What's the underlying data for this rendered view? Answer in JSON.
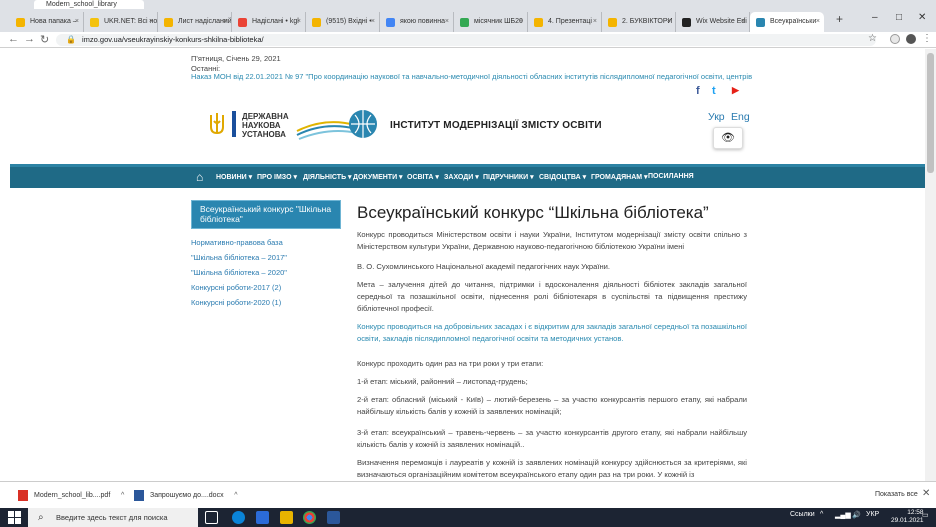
{
  "window": {
    "title": "Modern_school_library"
  },
  "tabs": [
    {
      "label": "Нова папака – ",
      "color": "#f4b400"
    },
    {
      "label": "UKR.NET: Всі но",
      "color": "#f4c20d"
    },
    {
      "label": "Лист надісланий",
      "color": "#f4b400"
    },
    {
      "label": "Надіслані • kgl",
      "color": "#ea4335"
    },
    {
      "label": "(9515) Вхідні • ",
      "color": "#f4b400"
    },
    {
      "label": "якою повинна",
      "color": "#4285f4"
    },
    {
      "label": "місячник ШБ20",
      "color": "#34a853"
    },
    {
      "label": "4. Презентаці",
      "color": "#f4b400"
    },
    {
      "label": "2. БУКВІКТОРИ",
      "color": "#f4b400"
    },
    {
      "label": "Wix Website Edi",
      "color": "#222222"
    },
    {
      "label": "Всеукраїнськи",
      "color": "#2a86b0"
    }
  ],
  "address": {
    "url": "imzo.gov.ua/vseukrayinskiy-konkurs-shkilna-biblioteka/"
  },
  "site": {
    "date": "П'ятниця, Січень 29, 2021",
    "latest_label": "Останні:",
    "ticker": "Наказ МОН від 22.01.2021 № 97 \"Про координацію наукової та навчально-методичної діяльності обласних інститутів післядипломної педагогічної освіти, центрів",
    "state_lines": [
      "ДЕРЖАВНА",
      "НАУКОВА",
      "УСТАНОВА"
    ],
    "institute": "ІНСТИТУТ МОДЕРНІЗАЦІЇ ЗМІСТУ ОСВІТИ",
    "lang_ukr": "Укр",
    "lang_eng": "Eng",
    "social": {
      "facebook": "f",
      "twitter": "t",
      "youtube": "▶"
    }
  },
  "menu": [
    "НОВИНИ ▾",
    "ПРО ІМЗО ▾",
    "ДІЯЛЬНІСТЬ ▾",
    "ДОКУМЕНТИ ▾",
    "ОСВІТА ▾",
    "ЗАХОДИ ▾",
    "ПІДРУЧНИКИ ▾",
    "СВІДОЦТВА ▾",
    "ГРОМАДЯНАМ ▾",
    "ПОСИЛАННЯ"
  ],
  "sidebar": {
    "heading": "Всеукраїнський конкурс \"Шкільна бібліотека\"",
    "links": [
      "Нормативно-правова база",
      "\"Шкільна бібліотека – 2017\"",
      "\"Шкільна бібліотека – 2020\"",
      "Конкурсні роботи-2017 (2)",
      "Конкурсні роботи-2020 (1)"
    ]
  },
  "article": {
    "title": "Всеукраїнський конкурс “Шкільна бібліотека”",
    "paragraphs": [
      "Конкурс проводиться Міністерством освіти і науки України, Інститутом модернізації змісту освіти спільно з Міністерством культури України, Державною науково-педагогічною бібліотекою України імені",
      "В. О. Сухомлинського Національної академії педагогічних наук України.",
      "Мета – залучення дітей до читання, підтримки і вдосконалення діяльності бібліотек закладів загальної середньої та позашкільної освіти, піднесення ролі бібліотекаря в суспільстві та підвищення престижу бібліотечної професії.",
      "Конкурс проводиться на добровільних засадах і є відкритим для закладів загальної середньої та позашкільної освіти, закладів післядипломної педагогічної освіти та методичних установ.",
      "Конкурс проходить один раз на три роки у три етапи:",
      "1-й етап: міський, районний – листопад-грудень;",
      "2-й етап: обласний (міський - Київ) – лютий-березень – за участю конкурсантів першого етапу, які набрали найбільшу кількість балів у кожній із заявлених номінацій;",
      "3-й етап: всеукраїнський – травень-червень – за участю конкурсантів другого етапу, які набрали найбільшу кількість балів у кожній із заявлених номінацій..",
      "Визначення переможців і лауреатів у кожній із заявлених номінацій конкурсу здійснюється за критеріями, які визначаються організаційним комітетом всеукраїнського етапу один раз на три роки. У кожній із"
    ]
  },
  "downloads": [
    {
      "name": "Modern_school_lib....pdf",
      "color": "#d93025"
    },
    {
      "name": "Запрошуємо до....docx",
      "color": "#2b579a"
    }
  ],
  "downloads_show_all": "Показать все",
  "taskbar": {
    "search_placeholder": "Введите здесь текст для поиска",
    "links_label": "Ссылки",
    "lang": "УКР",
    "time": "12:58",
    "date": "29.01.2021"
  }
}
